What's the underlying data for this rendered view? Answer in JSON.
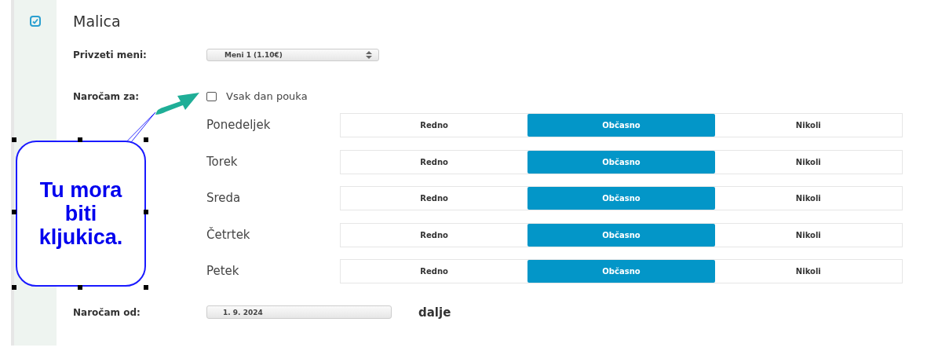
{
  "section": {
    "title": "Malica",
    "checked": true
  },
  "menu": {
    "label": "Privzeti meni:",
    "value": "Meni 1 (1.10€)"
  },
  "order_for": {
    "label": "Naročam za:",
    "every_day": {
      "label": "Vsak dan pouka",
      "checked": false
    }
  },
  "days": [
    {
      "name": "Ponedeljek",
      "options": [
        {
          "label": "Redno",
          "selected": false
        },
        {
          "label": "Občasno",
          "selected": true
        },
        {
          "label": "Nikoli",
          "selected": false
        }
      ]
    },
    {
      "name": "Torek",
      "options": [
        {
          "label": "Redno",
          "selected": false
        },
        {
          "label": "Občasno",
          "selected": true
        },
        {
          "label": "Nikoli",
          "selected": false
        }
      ]
    },
    {
      "name": "Sreda",
      "options": [
        {
          "label": "Redno",
          "selected": false
        },
        {
          "label": "Občasno",
          "selected": true
        },
        {
          "label": "Nikoli",
          "selected": false
        }
      ]
    },
    {
      "name": "Četrtek",
      "options": [
        {
          "label": "Redno",
          "selected": false
        },
        {
          "label": "Občasno",
          "selected": true
        },
        {
          "label": "Nikoli",
          "selected": false
        }
      ]
    },
    {
      "name": "Petek",
      "options": [
        {
          "label": "Redno",
          "selected": false
        },
        {
          "label": "Občasno",
          "selected": true
        },
        {
          "label": "Nikoli",
          "selected": false
        }
      ]
    }
  ],
  "order_from": {
    "label": "Naročam od:",
    "value": "1. 9. 2024",
    "suffix": "dalje"
  },
  "callout": {
    "text": "Tu mora biti kljukica."
  }
}
